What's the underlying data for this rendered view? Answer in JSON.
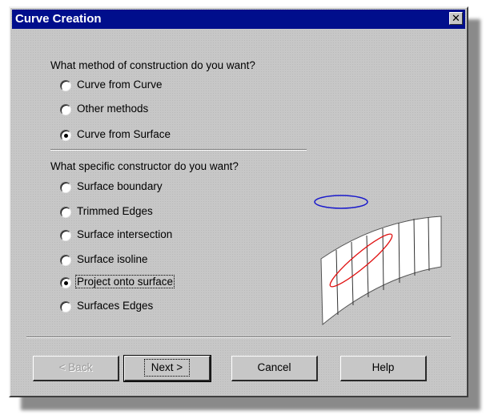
{
  "window": {
    "title": "Curve Creation",
    "title_bar_color": "#000e8c",
    "close_symbol": "✕"
  },
  "method_section": {
    "prompt": "What method of construction do you want?",
    "options": [
      {
        "label": "Curve from Curve",
        "checked": false
      },
      {
        "label": "Other methods",
        "checked": false
      },
      {
        "label": "Curve from Surface",
        "checked": true
      }
    ]
  },
  "constructor_section": {
    "prompt": "What specific constructor do you want?",
    "options": [
      {
        "label": "Surface boundary",
        "checked": false
      },
      {
        "label": "Trimmed Edges",
        "checked": false
      },
      {
        "label": "Surface intersection",
        "checked": false
      },
      {
        "label": "Surface isoline",
        "checked": false
      },
      {
        "label": "Project onto surface",
        "checked": true
      },
      {
        "label": "Surfaces Edges",
        "checked": false
      }
    ]
  },
  "buttons": {
    "back": "< Back",
    "next": "Next >",
    "cancel": "Cancel",
    "help": "Help"
  },
  "illustration": {
    "ellipse_color": "#1a1acc",
    "projected_curve_color": "#e01010",
    "surface_color": "#ffffff",
    "icon": "projection-illustration"
  }
}
